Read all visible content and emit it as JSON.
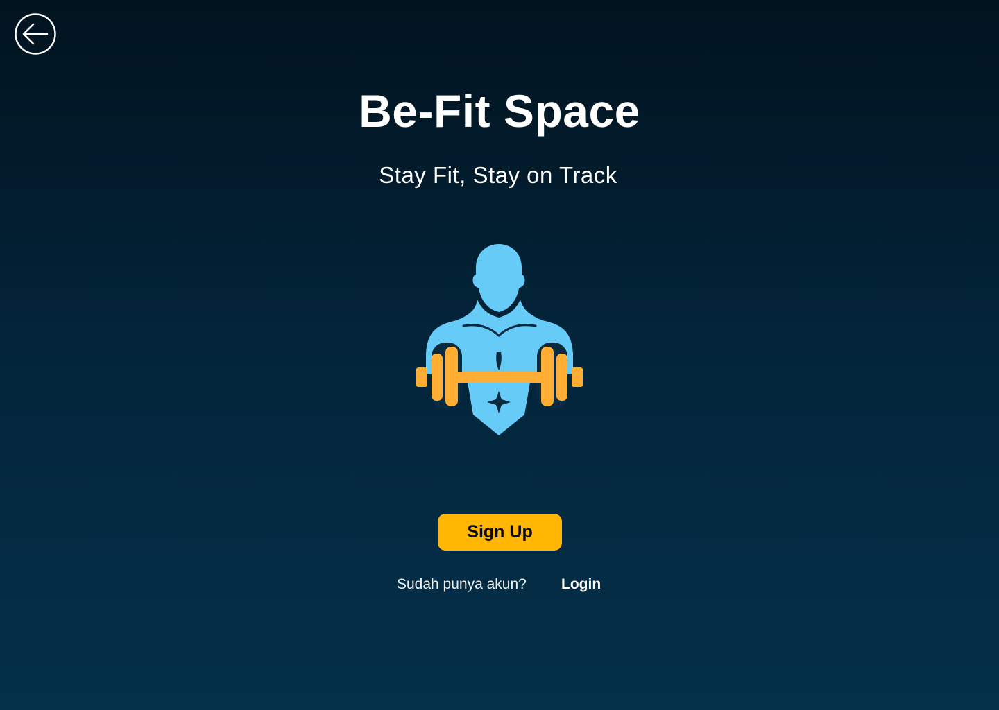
{
  "nav": {
    "back_icon": "arrow-left-circle-icon"
  },
  "hero": {
    "title": "Be-Fit Space",
    "subtitle": "Stay Fit, Stay on Track",
    "illustration": "bodybuilder-with-barbell-icon"
  },
  "actions": {
    "signup_label": "Sign Up",
    "login_prompt": "Sudah punya akun?",
    "login_label": "Login"
  },
  "colors": {
    "background_top": "#01131f",
    "background_bottom": "#04304a",
    "accent": "#ffb703",
    "figure": "#66ccf7",
    "barbell": "#ffad33"
  }
}
